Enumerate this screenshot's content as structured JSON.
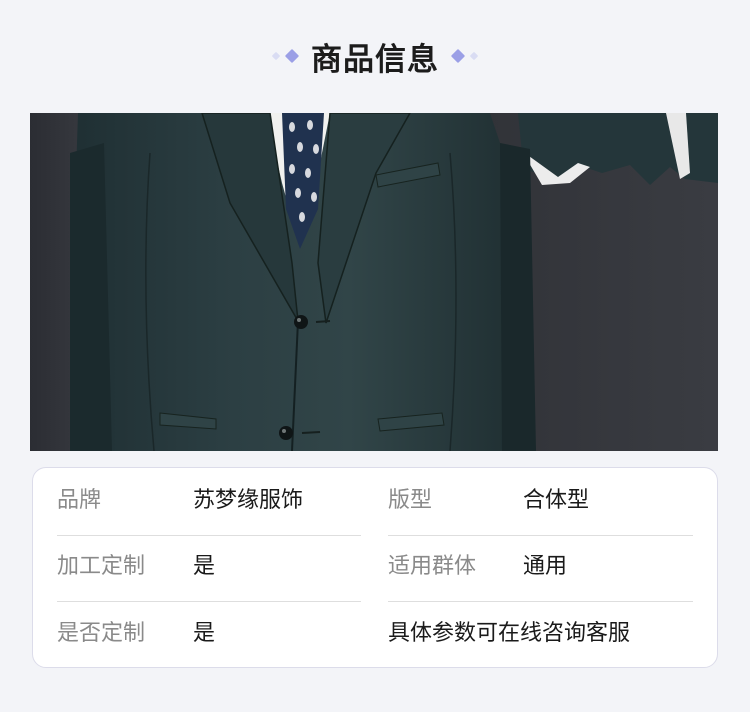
{
  "header": {
    "title": "商品信息"
  },
  "product_image": {
    "alt": "suit-jacket-photo"
  },
  "info": {
    "rows": [
      {
        "label1": "品牌",
        "value1": "苏梦缘服饰",
        "label2": "版型",
        "value2": "合体型"
      },
      {
        "label1": "加工定制",
        "value1": "是",
        "label2": "适用群体",
        "value2": "通用"
      },
      {
        "label1": "是否定制",
        "value1": "是",
        "note": "具体参数可在线咨询客服"
      }
    ]
  },
  "colors": {
    "accent_diamond": "#9b9fe6",
    "accent_diamond_light": "#d9dcf3",
    "suit": "#2a3b3e",
    "background": "#f3f4f8"
  }
}
